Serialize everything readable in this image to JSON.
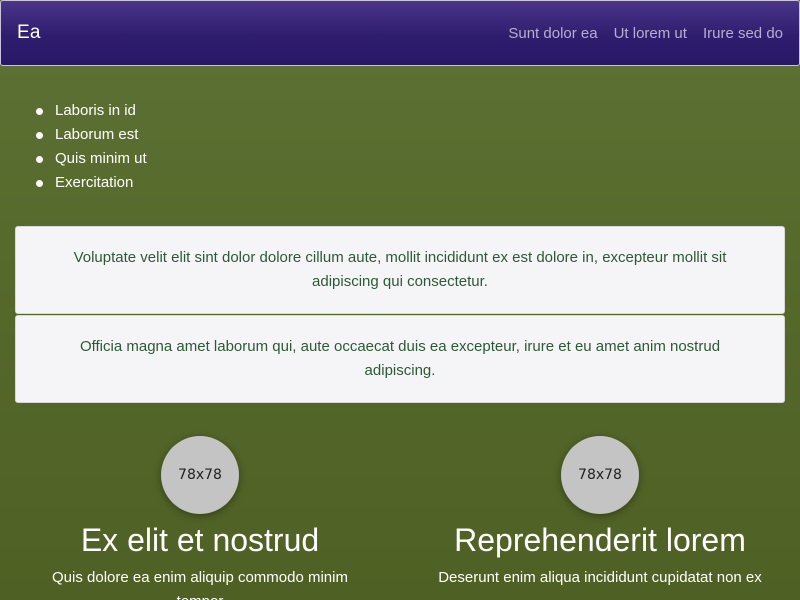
{
  "navbar": {
    "brand": "Ea",
    "links": [
      "Sunt dolor ea",
      "Ut lorem ut",
      "Irure sed do"
    ]
  },
  "list": {
    "items": [
      "Laboris in id",
      "Laborum est",
      "Quis minim ut",
      "Exercitation"
    ]
  },
  "cards": [
    {
      "text": "Voluptate velit elit sint dolor dolore cillum aute, mollit incididunt ex est dolore in, excepteur mollit sit adipiscing qui consectetur."
    },
    {
      "text": "Officia magna amet laborum qui, aute occaecat duis ea excepteur, irure et eu amet anim nostrud adipiscing."
    }
  ],
  "features": [
    {
      "image_label": "78x78",
      "title": "Ex elit et nostrud",
      "text": "Quis dolore ea enim aliquip commodo minim tempor"
    },
    {
      "image_label": "78x78",
      "title": "Reprehenderit lorem",
      "text": "Deserunt enim aliqua incididunt cupidatat non ex"
    }
  ],
  "colors": {
    "navbar": "#2f1d6e",
    "background": "#566a2c",
    "card_text": "#2c5a35",
    "card_bg": "#f5f5f7"
  }
}
